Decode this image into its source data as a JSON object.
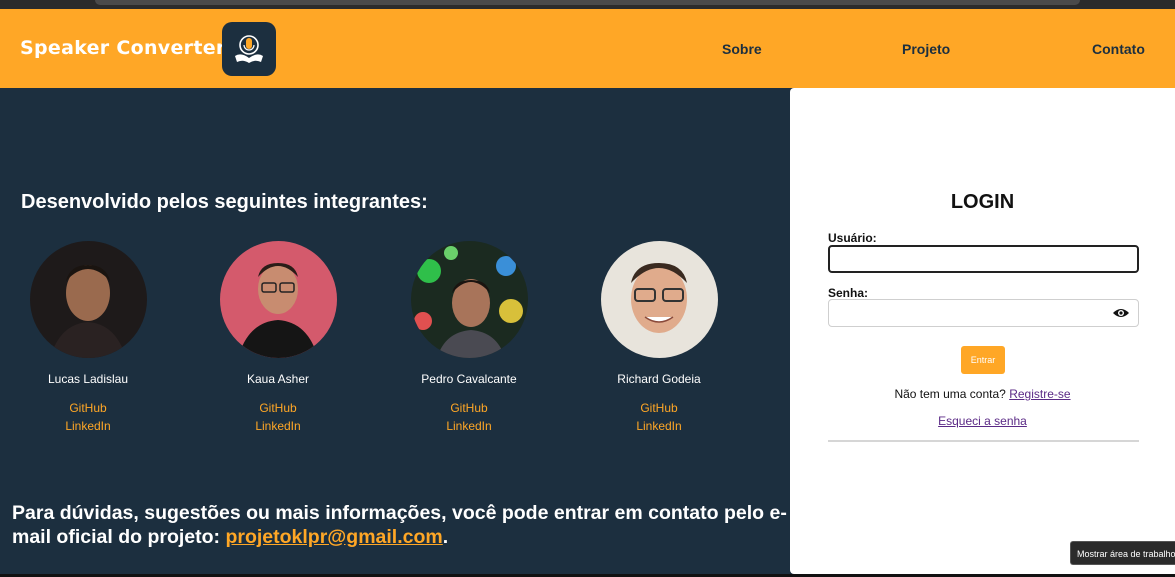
{
  "navbar": {
    "brand": "Speaker Converter",
    "links": [
      "Sobre",
      "Projeto",
      "Contato"
    ]
  },
  "team": {
    "title": "Desenvolvido pelos seguintes integrantes:",
    "members": [
      {
        "name": "Lucas Ladislau",
        "github": "GitHub",
        "linkedin": "LinkedIn"
      },
      {
        "name": "Kaua Asher",
        "github": "GitHub",
        "linkedin": "LinkedIn"
      },
      {
        "name": "Pedro Cavalcante",
        "github": "GitHub",
        "linkedin": "LinkedIn"
      },
      {
        "name": "Richard Godeia",
        "github": "GitHub",
        "linkedin": "LinkedIn"
      }
    ]
  },
  "contact": {
    "text": "Para dúvidas, sugestões ou mais informações, você pode entrar em contato pelo e-mail oficial do projeto: ",
    "email": "projetoklpr@gmail.com",
    "end": "."
  },
  "login": {
    "title": "LOGIN",
    "user_label": "Usuário:",
    "user_value": "",
    "password_label": "Senha:",
    "password_value": "",
    "submit": "Entrar",
    "no_account": "Não tem uma conta?",
    "register": "Registre-se",
    "forgot": "Esqueci a senha"
  },
  "tooltip": "Mostrar área de trabalho",
  "colors": {
    "accent": "#ffa726",
    "background": "#1c2f3f",
    "link": "#5b2a86"
  }
}
